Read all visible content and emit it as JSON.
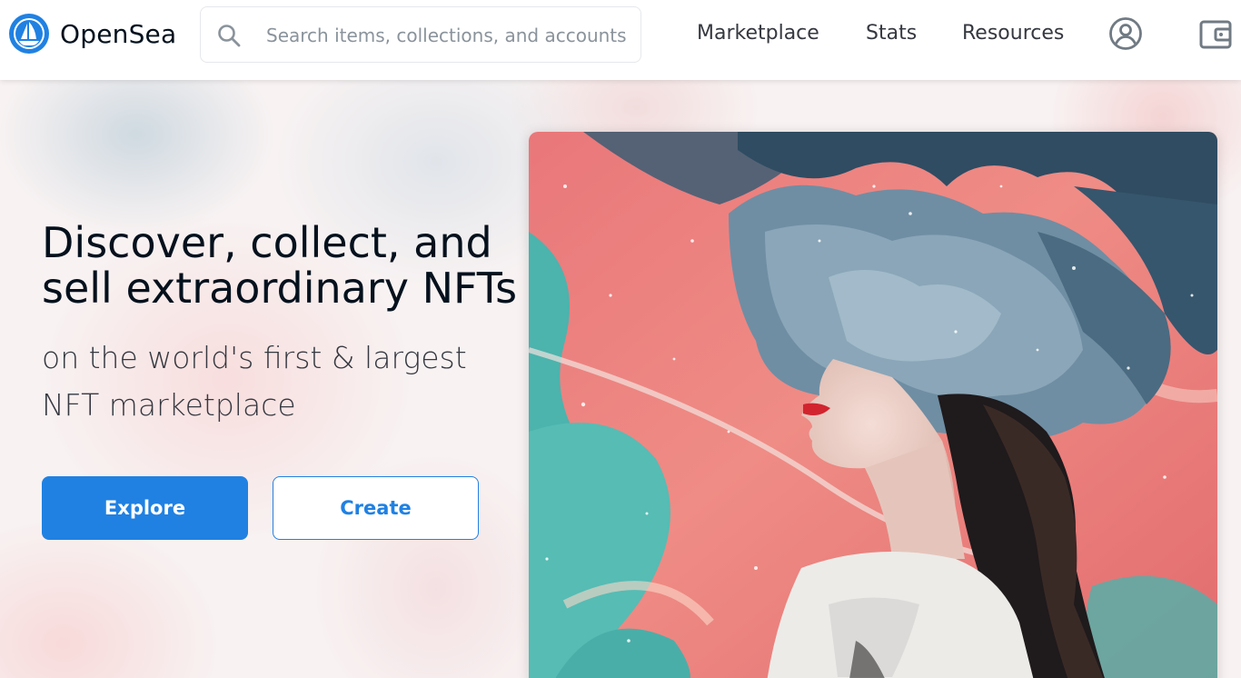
{
  "header": {
    "brand": "OpenSea",
    "search": {
      "placeholder": "Search items, collections, and accounts"
    },
    "nav": {
      "marketplace": "Marketplace",
      "stats": "Stats",
      "resources": "Resources"
    },
    "icons": {
      "logo": "opensea-logo",
      "search": "search-icon",
      "account": "account-circle-icon",
      "wallet": "wallet-icon"
    }
  },
  "hero": {
    "headline": "Discover, collect, and sell extraordinary NFTs",
    "subline": "on the world's first & largest NFT marketplace",
    "explore_label": "Explore",
    "create_label": "Create"
  },
  "colors": {
    "accent": "#2081e2",
    "text": "#04111d",
    "muted": "#8a939b"
  }
}
